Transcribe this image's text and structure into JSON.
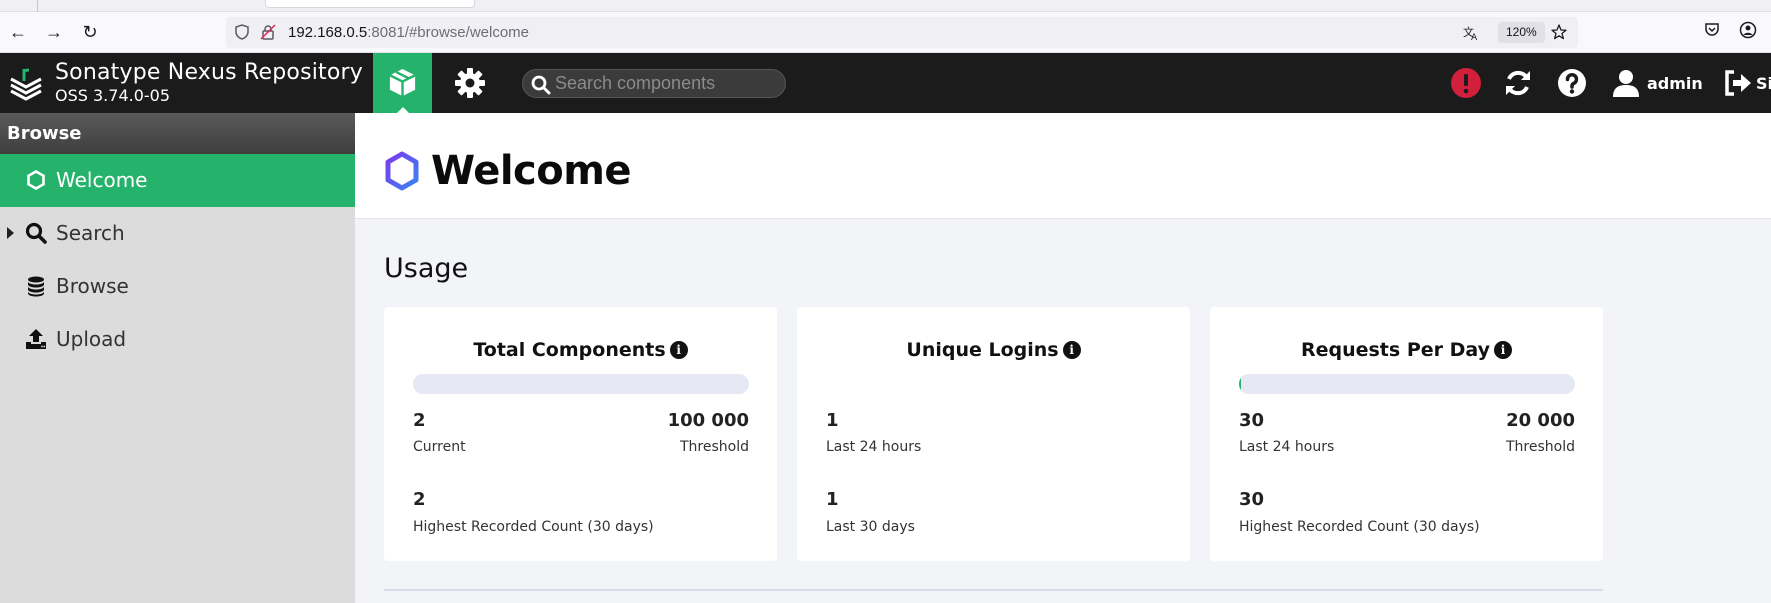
{
  "browser": {
    "url_host": "192.168.0.5",
    "url_rest": ":8081/#browse/welcome",
    "zoom": "120%"
  },
  "header": {
    "brand_title": "Sonatype Nexus Repository",
    "brand_version": "OSS 3.74.0-05",
    "search_placeholder": "Search components",
    "user_name": "admin",
    "signout_label": "Si"
  },
  "sidebar": {
    "heading": "Browse",
    "items": [
      {
        "label": "Welcome",
        "icon": "hexagon-icon",
        "active": true
      },
      {
        "label": "Search",
        "icon": "search-icon",
        "expandable": true
      },
      {
        "label": "Browse",
        "icon": "database-icon"
      },
      {
        "label": "Upload",
        "icon": "upload-icon"
      }
    ]
  },
  "main": {
    "page_title": "Welcome",
    "section_title": "Usage",
    "cards": [
      {
        "title": "Total Components",
        "progress": 2e-05,
        "left_value": "2",
        "left_caption": "Current",
        "right_value": "100 000",
        "right_caption": "Threshold",
        "bottom_value": "2",
        "bottom_caption": "Highest Recorded Count (30 days)"
      },
      {
        "title": "Unique Logins",
        "top_value": "1",
        "top_caption": "Last 24 hours",
        "bottom_value": "1",
        "bottom_caption": "Last 30 days"
      },
      {
        "title": "Requests Per Day",
        "progress": 0.0015,
        "left_value": "30",
        "left_caption": "Last 24 hours",
        "right_value": "20 000",
        "right_caption": "Threshold",
        "bottom_value": "30",
        "bottom_caption": "Highest Recorded Count (30 days)"
      }
    ]
  },
  "colors": {
    "accent_green": "#25b36b",
    "header_bg": "#1b1b1b",
    "alert_red": "#d21f3c"
  }
}
